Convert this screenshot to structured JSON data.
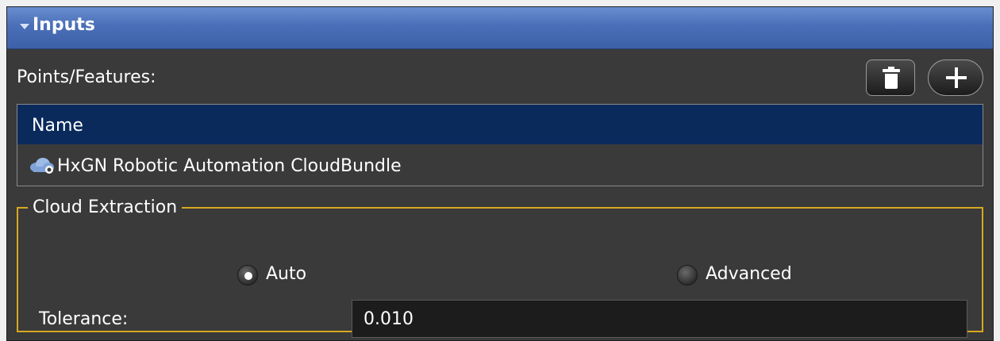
{
  "panel": {
    "title": "Inputs"
  },
  "points": {
    "label": "Points/Features:",
    "delete_icon": "trash-icon",
    "add_icon": "plus-icon"
  },
  "table": {
    "columns": [
      "Name"
    ],
    "rows": [
      {
        "icon": "cloud-icon",
        "name": "HxGN Robotic Automation CloudBundle"
      }
    ]
  },
  "cloud_extraction": {
    "legend": "Cloud Extraction",
    "options": [
      {
        "label": "Auto",
        "selected": true
      },
      {
        "label": "Advanced",
        "selected": false
      }
    ],
    "tolerance_label": "Tolerance:",
    "tolerance_value": "0.010"
  },
  "colors": {
    "header_blue": "#4a6fb8",
    "table_header": "#0a2a5c",
    "group_border": "#d9a820",
    "panel_bg": "#3a3a3a",
    "input_bg": "#1c1c1c"
  }
}
